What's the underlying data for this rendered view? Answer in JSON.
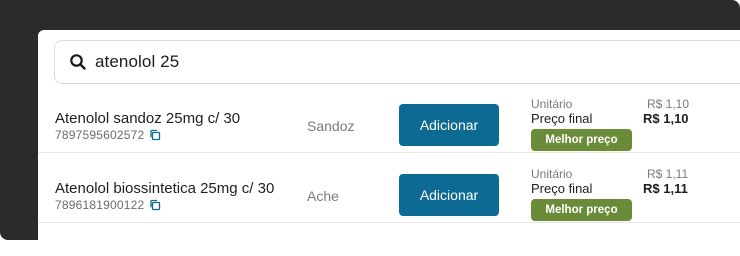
{
  "search": {
    "value": "atenolol 25"
  },
  "results": [
    {
      "name": "Atenolol sandoz 25mg c/ 30",
      "ean": "7897595602572",
      "brand": "Sandoz",
      "add_label": "Adicionar",
      "unit_label": "Unitário",
      "unit_price": "R$ 1,10",
      "final_label": "Preço final",
      "final_price": "R$ 1,10",
      "badge": "Melhor preço"
    },
    {
      "name": "Atenolol biossintetica 25mg c/ 30",
      "ean": "7896181900122",
      "brand": "Ache",
      "add_label": "Adicionar",
      "unit_label": "Unitário",
      "unit_price": "R$ 1,11",
      "final_label": "Preço final",
      "final_price": "R$ 1,11",
      "badge": "Melhor preço"
    }
  ],
  "colors": {
    "primary_button": "#0c6a93",
    "badge": "#6a8c38",
    "backdrop": "#2b2b2d"
  },
  "icons": {
    "search": "search-icon",
    "copy": "copy-icon"
  }
}
